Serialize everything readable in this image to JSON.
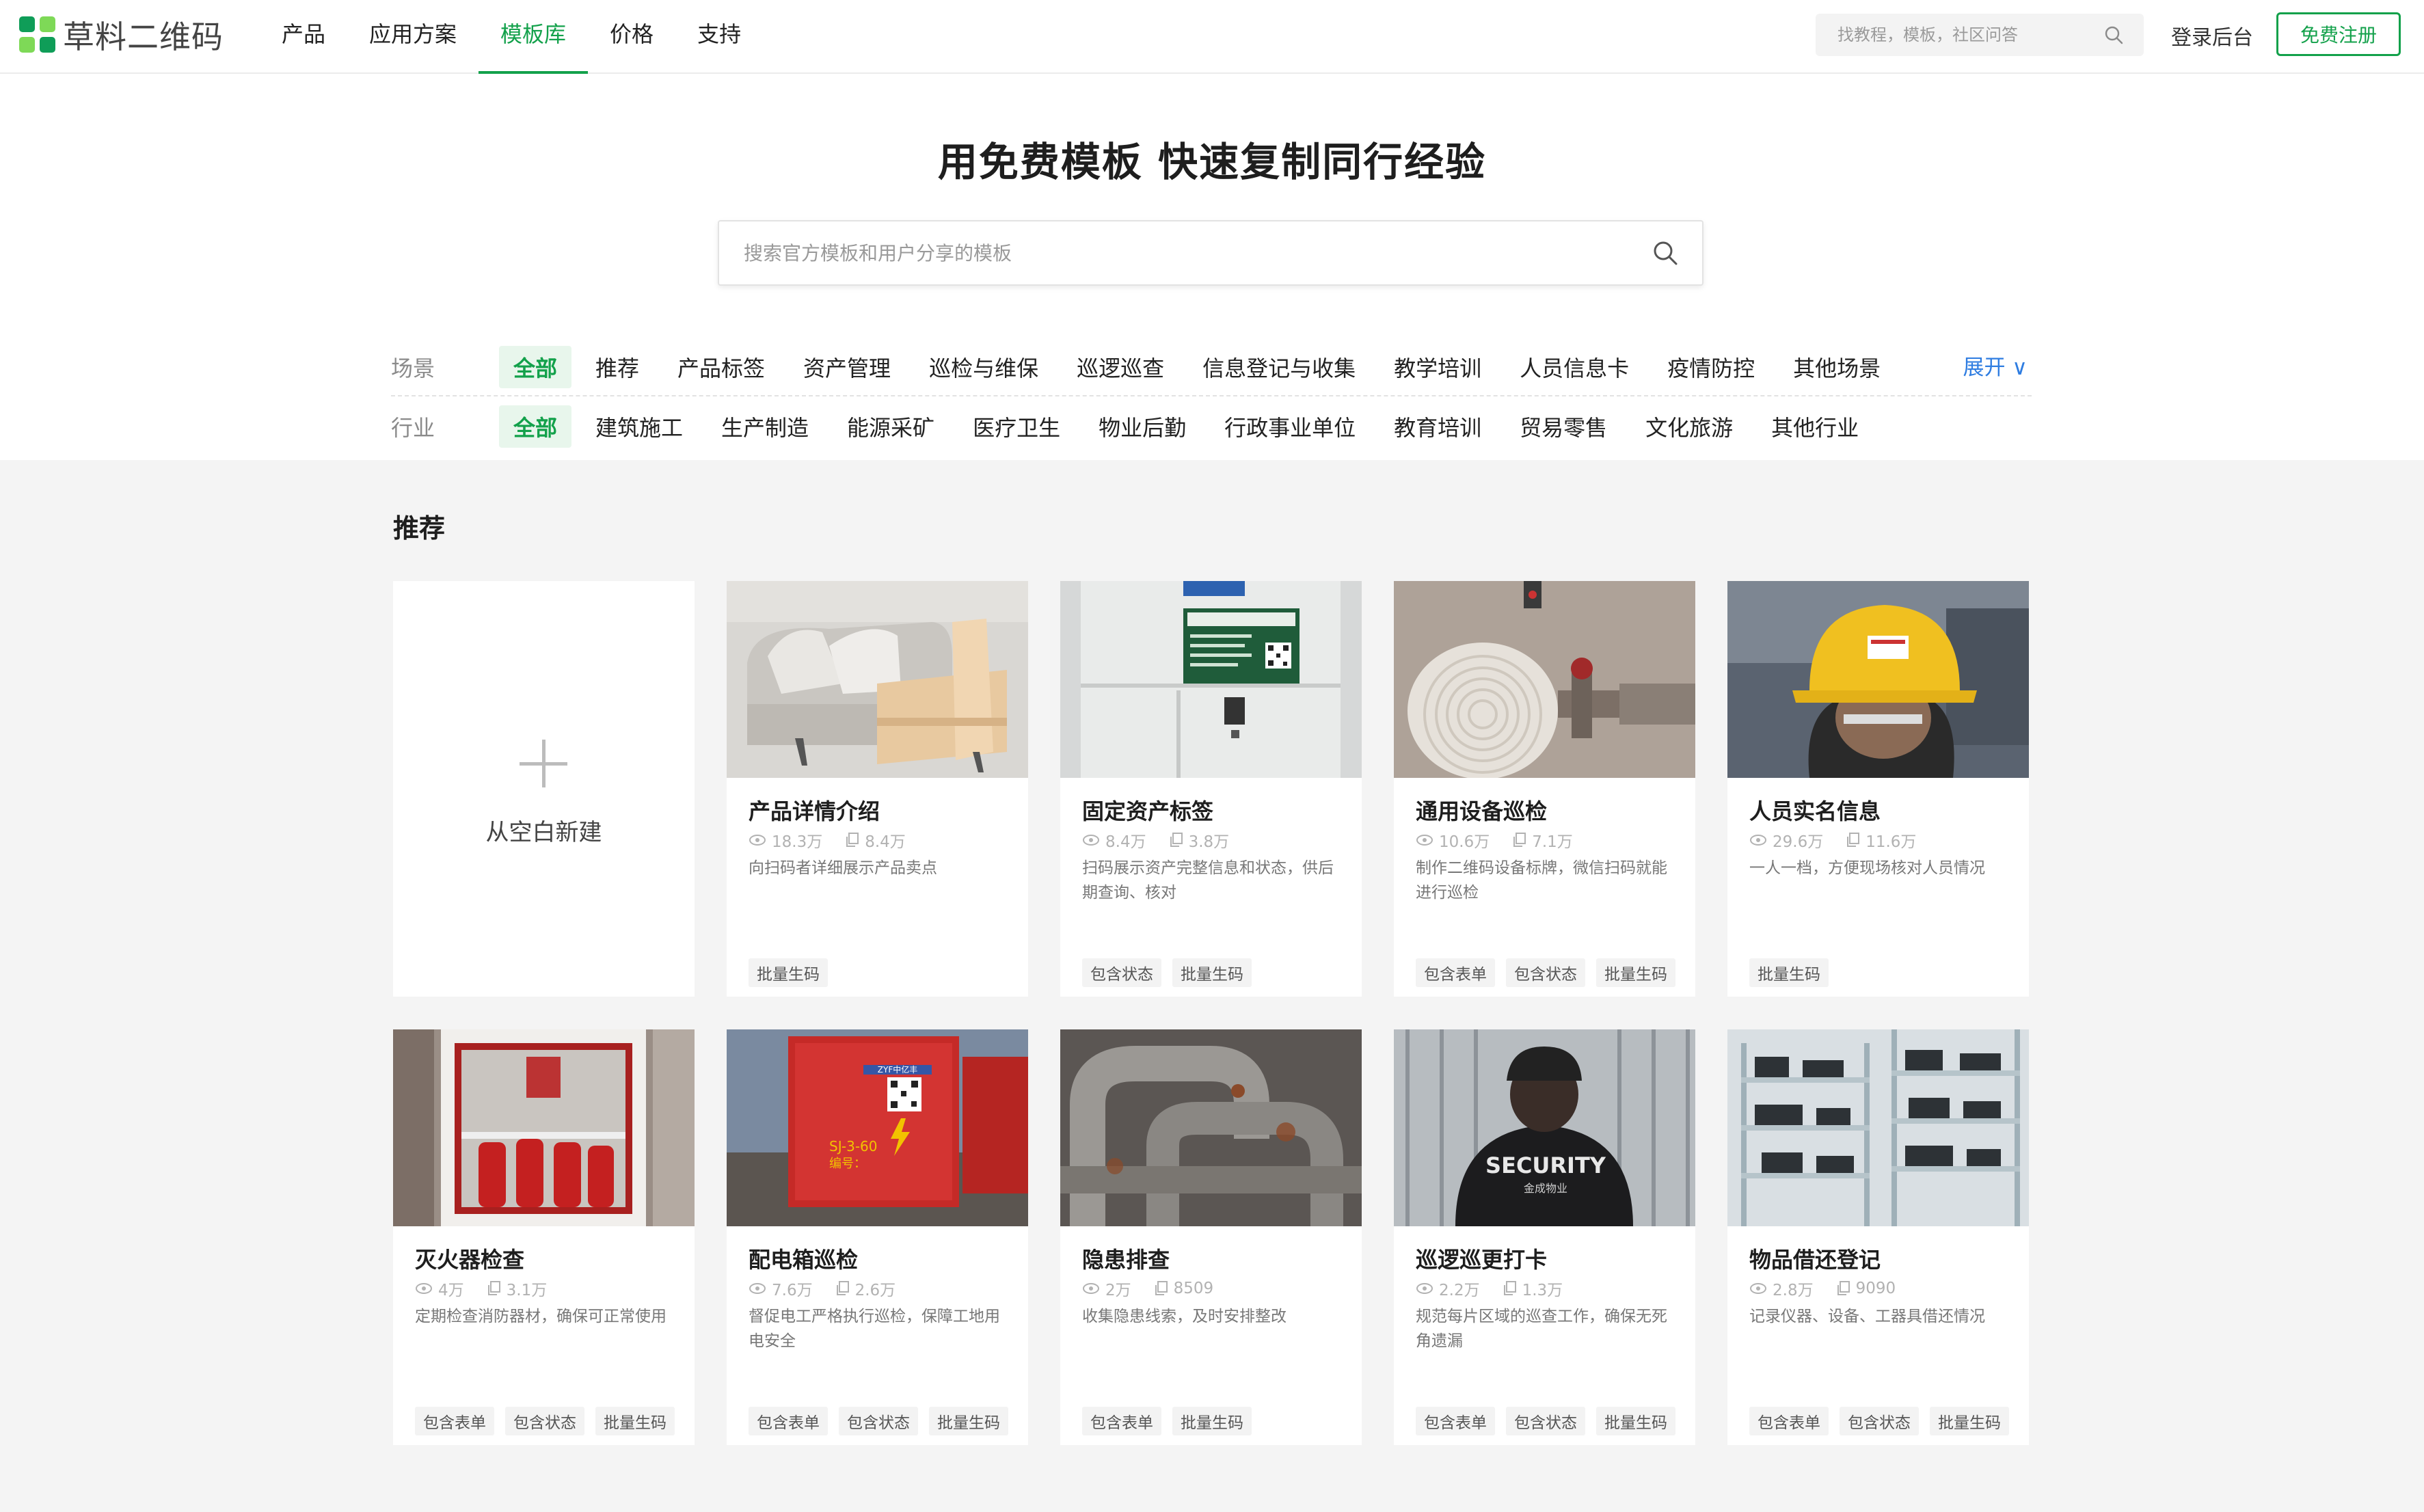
{
  "brand": {
    "name": "草料二维码",
    "accent": "#13a14b"
  },
  "nav": {
    "items": [
      {
        "label": "产品"
      },
      {
        "label": "应用方案"
      },
      {
        "label": "模板库",
        "active": true
      },
      {
        "label": "价格"
      },
      {
        "label": "支持"
      }
    ]
  },
  "top_search": {
    "placeholder": "找教程，模板，社区问答"
  },
  "auth": {
    "login_label": "登录后台",
    "signup_label": "免费注册"
  },
  "hero": {
    "title": "用免费模板 快速复制同行经验",
    "search_placeholder": "搜索官方模板和用户分享的模板"
  },
  "filters": {
    "scene": {
      "label": "场景",
      "options": [
        "全部",
        "推荐",
        "产品标签",
        "资产管理",
        "巡检与维保",
        "巡逻巡查",
        "信息登记与收集",
        "教学培训",
        "人员信息卡",
        "疫情防控",
        "其他场景"
      ],
      "selected": "全部",
      "expand_label": "展开 ∨"
    },
    "industry": {
      "label": "行业",
      "options": [
        "全部",
        "建筑施工",
        "生产制造",
        "能源采矿",
        "医疗卫生",
        "物业后勤",
        "行政事业单位",
        "教育培训",
        "贸易零售",
        "文化旅游",
        "其他行业"
      ],
      "selected": "全部"
    }
  },
  "section": {
    "title": "推荐"
  },
  "blank_card": {
    "label": "从空白新建"
  },
  "templates": [
    {
      "title": "产品详情介绍",
      "views": "18.3万",
      "copies": "8.4万",
      "desc": "向扫码者详细展示产品卖点",
      "tags": [
        "批量生码"
      ],
      "image": "sofa"
    },
    {
      "title": "固定资产标签",
      "views": "8.4万",
      "copies": "3.8万",
      "desc": "扫码展示资产完整信息和状态，供后期查询、核对",
      "tags": [
        "包含状态",
        "批量生码"
      ],
      "image": "machine"
    },
    {
      "title": "通用设备巡检",
      "views": "10.6万",
      "copies": "7.1万",
      "desc": "制作二维码设备标牌，微信扫码就能进行巡检",
      "tags": [
        "包含表单",
        "包含状态",
        "批量生码"
      ],
      "image": "fire-hose"
    },
    {
      "title": "人员实名信息",
      "views": "29.6万",
      "copies": "11.6万",
      "desc": "一人一档，方便现场核对人员情况",
      "tags": [
        "批量生码"
      ],
      "image": "helmet"
    },
    {
      "title": "灭火器检查",
      "views": "4万",
      "copies": "3.1万",
      "desc": "定期检查消防器材，确保可正常使用",
      "tags": [
        "包含表单",
        "包含状态",
        "批量生码"
      ],
      "image": "extinguisher"
    },
    {
      "title": "配电箱巡检",
      "views": "7.6万",
      "copies": "2.6万",
      "desc": "督促电工严格执行巡检，保障工地用电安全",
      "tags": [
        "包含表单",
        "包含状态",
        "批量生码"
      ],
      "image": "power-box",
      "image_text": [
        "ZYF中亿丰",
        "SJ-3-60",
        "编号："
      ]
    },
    {
      "title": "隐患排查",
      "views": "2万",
      "copies": "8509",
      "desc": "收集隐患线索，及时安排整改",
      "tags": [
        "包含表单",
        "批量生码"
      ],
      "image": "pipes"
    },
    {
      "title": "巡逻巡更打卡",
      "views": "2.2万",
      "copies": "1.3万",
      "desc": "规范每片区域的巡查工作，确保无死角遗漏",
      "tags": [
        "包含表单",
        "包含状态",
        "批量生码"
      ],
      "image": "security",
      "image_text": [
        "SECURITY",
        "金成物业"
      ]
    },
    {
      "title": "物品借还登记",
      "views": "2.8万",
      "copies": "9090",
      "desc": "记录仪器、设备、工器具借还情况",
      "tags": [
        "包含表单",
        "包含状态",
        "批量生码"
      ],
      "image": "shelves"
    }
  ]
}
